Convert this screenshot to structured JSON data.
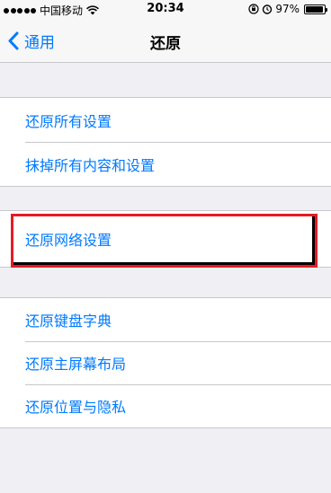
{
  "status_bar": {
    "carrier": "中国移动",
    "time": "20:34",
    "battery_text": "97%",
    "battery_level": 0.97
  },
  "nav": {
    "back_label": "通用",
    "title": "还原"
  },
  "groups": [
    {
      "items": [
        "还原所有设置",
        "抹掉所有内容和设置"
      ]
    },
    {
      "items": [
        "还原网络设置"
      ]
    },
    {
      "items": [
        "还原键盘字典",
        "还原主屏幕布局",
        "还原位置与隐私"
      ]
    }
  ],
  "colors": {
    "accent": "#007aff",
    "highlight": "#e61c24",
    "background": "#efeff4"
  }
}
